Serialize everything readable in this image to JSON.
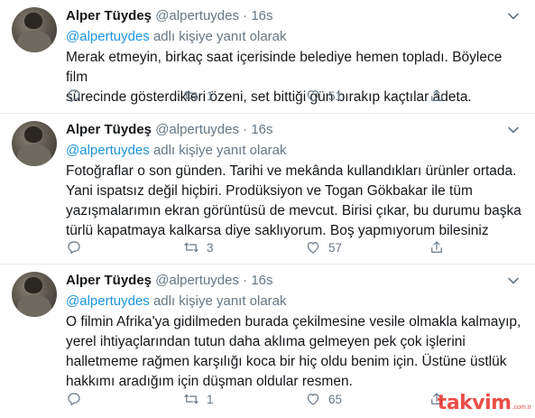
{
  "tweets": [
    {
      "name": "Alper Tüydeş",
      "handle": "@alpertuydes",
      "dot": "·",
      "time": "16s",
      "reply_mention": "@alpertuydes",
      "reply_suffix": " adlı kişiye yanıt olarak",
      "text": "Merak etmeyin, birkaç saat içerisinde belediye hemen topladı. Böylece film\nsürecinde gösterdikleri özeni, set bittiği gün bırakıp kaçtılar adeta.",
      "retweets": "1",
      "likes": "51"
    },
    {
      "name": "Alper Tüydeş",
      "handle": "@alpertuydes",
      "dot": "·",
      "time": "16s",
      "reply_mention": "@alpertuydes",
      "reply_suffix": " adlı kişiye yanıt olarak",
      "text": "Fotoğraflar o son günden. Tarihi ve mekânda kullandıkları ürünler ortada.\nYani ispatsız değil hiçbiri. Prodüksiyon ve Togan Gökbakar ile tüm\nyazışmalarımın ekran görüntüsü de mevcut. Birisi çıkar, bu durumu başka\ntürlü kapatmaya kalkarsa diye saklıyorum. Boş yapmıyorum bilesiniz",
      "retweets": "3",
      "likes": "57"
    },
    {
      "name": "Alper Tüydeş",
      "handle": "@alpertuydes",
      "dot": "·",
      "time": "16s",
      "reply_mention": "@alpertuydes",
      "reply_suffix": " adlı kişiye yanıt olarak",
      "text": "O filmin Afrika'ya gidilmeden burada çekilmesine vesile olmakla kalmayıp,\nyerel ihtiyaçlarından tutun daha aklıma gelmeyen pek çok işlerini\nhalletmeme rağmen karşılığı koca bir hiç oldu benim için. Üstüne üstlük\nhakkımı aradığım için düşman oldular resmen.",
      "retweets": "1",
      "likes": "65"
    }
  ],
  "icons": {
    "reply": "reply-icon",
    "retweet": "retweet-icon",
    "like": "heart-icon",
    "share": "share-icon",
    "caret": "chevron-down-icon"
  },
  "colors": {
    "text": "#14171a",
    "secondary": "#657786",
    "link": "#1b95e0",
    "divider": "#e6ecf0",
    "watermark": "#e8302a"
  },
  "watermark": {
    "brand": "takvim",
    "domain": ".com.tr"
  }
}
